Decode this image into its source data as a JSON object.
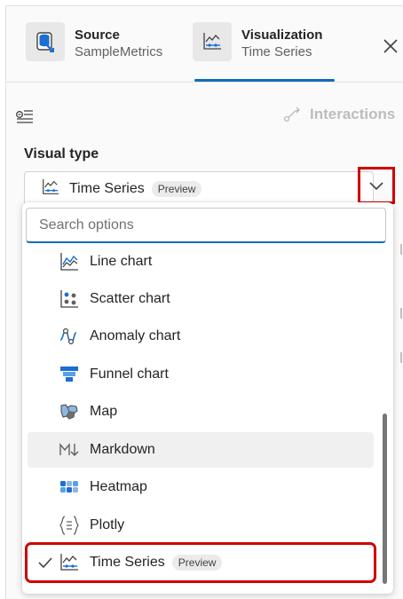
{
  "tabs": {
    "source": {
      "title": "Source",
      "subtitle": "SampleMetrics"
    },
    "visualization": {
      "title": "Visualization",
      "subtitle": "Time Series"
    }
  },
  "toolbar": {
    "interactions_label": "Interactions"
  },
  "visual_type": {
    "label": "Visual type",
    "selected": "Time Series",
    "selected_badge": "Preview"
  },
  "dropdown": {
    "search_placeholder": "Search options",
    "options": [
      {
        "label": "Line chart",
        "icon": "line-chart-icon"
      },
      {
        "label": "Scatter chart",
        "icon": "scatter-chart-icon"
      },
      {
        "label": "Anomaly chart",
        "icon": "anomaly-chart-icon"
      },
      {
        "label": "Funnel chart",
        "icon": "funnel-chart-icon"
      },
      {
        "label": "Map",
        "icon": "map-icon"
      },
      {
        "label": "Markdown",
        "icon": "markdown-icon"
      },
      {
        "label": "Heatmap",
        "icon": "heatmap-icon"
      },
      {
        "label": "Plotly",
        "icon": "plotly-icon"
      },
      {
        "label": "Time Series",
        "icon": "time-series-icon",
        "badge": "Preview",
        "selected": true
      }
    ]
  },
  "colors": {
    "accent": "#0f6cbd",
    "highlight_red": "#d00000"
  }
}
